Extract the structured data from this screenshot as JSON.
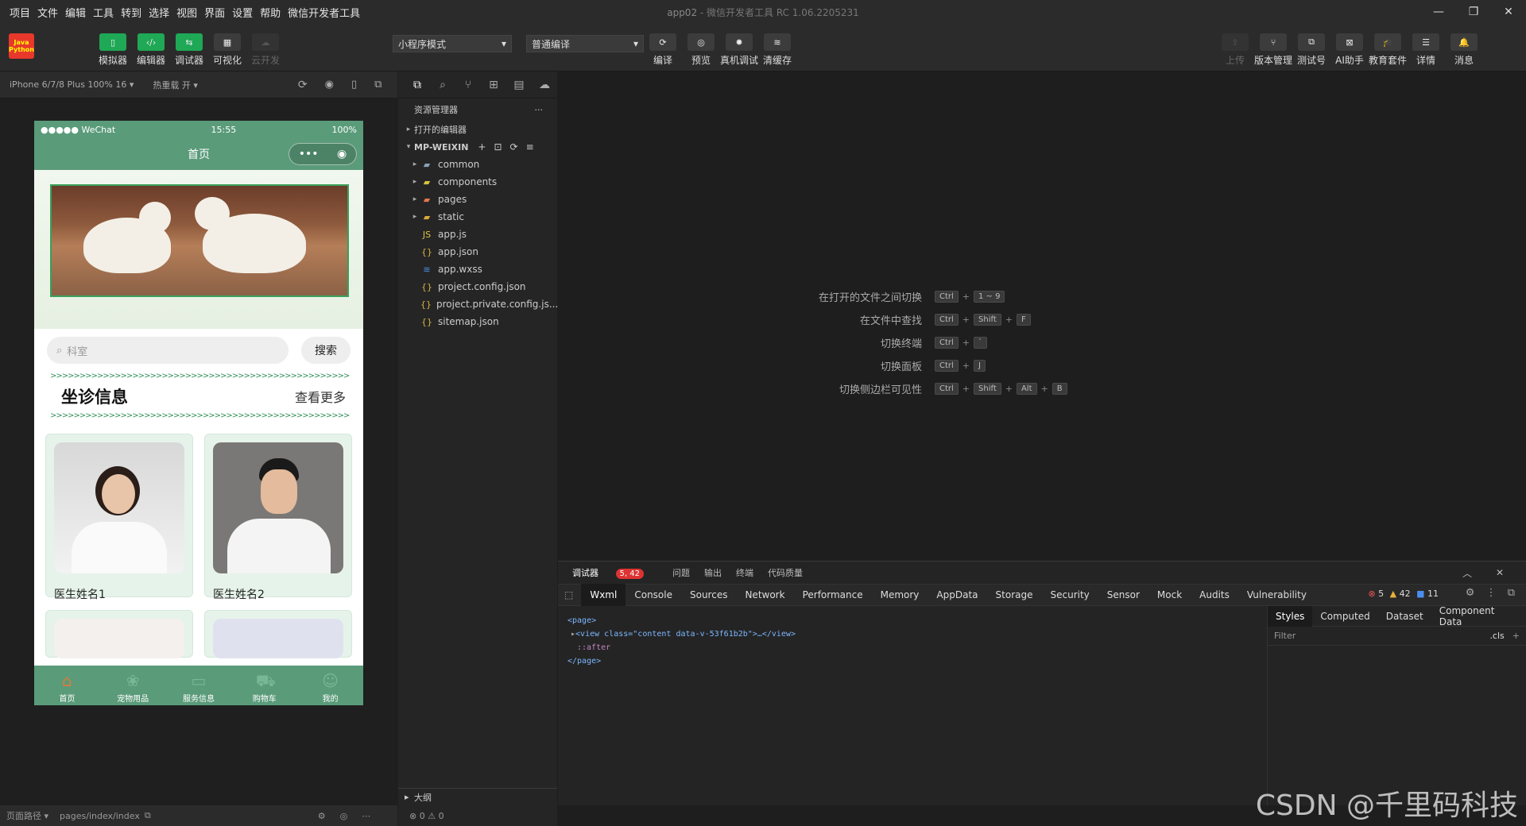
{
  "menu": [
    "项目",
    "文件",
    "编辑",
    "工具",
    "转到",
    "选择",
    "视图",
    "界面",
    "设置",
    "帮助",
    "微信开发者工具"
  ],
  "window": {
    "title": "app02",
    "subtitle": " - 微信开发者工具 RC 1.06.2205231"
  },
  "logo": {
    "line1": "Java",
    "line2": "Python"
  },
  "toolbar_left": [
    {
      "label": "模拟器",
      "icon": "phone-icon"
    },
    {
      "label": "编辑器",
      "icon": "code-icon"
    },
    {
      "label": "调试器",
      "icon": "debug-icon"
    },
    {
      "label": "可视化",
      "icon": "layout-icon"
    },
    {
      "label": "云开发",
      "icon": "cloud-icon"
    }
  ],
  "mode_select": "小程序模式",
  "compile_select": "普通编译",
  "toolbar_mid": [
    {
      "label": "编译"
    },
    {
      "label": "预览"
    },
    {
      "label": "真机调试"
    },
    {
      "label": "清缓存"
    }
  ],
  "toolbar_right": [
    {
      "label": "上传"
    },
    {
      "label": "版本管理"
    },
    {
      "label": "测试号"
    },
    {
      "label": "AI助手"
    },
    {
      "label": "教育套件"
    },
    {
      "label": "详情"
    },
    {
      "label": "消息"
    }
  ],
  "simbar": {
    "device": "iPhone 6/7/8 Plus 100% 16 ▾",
    "hotreload": "热重载 开 ▾"
  },
  "phone": {
    "carrier": "●●●●● WeChat",
    "time": "15:55",
    "battery": "100%",
    "nav_title": "首页",
    "search_placeholder": "科室",
    "search_button": "搜索",
    "arrows": ">>>>>>>>>>>>>>>>>>>>>>>>>>>>>>>>>>>>>>>>>>>>>>>>>>>",
    "section_title": "坐诊信息",
    "section_more": "查看更多",
    "doctors": [
      {
        "name": "医生姓名1"
      },
      {
        "name": "医生姓名2"
      }
    ],
    "tabs": [
      "首页",
      "宠物用品",
      "服务信息",
      "购物车",
      "我的"
    ]
  },
  "pathbar": {
    "label": "页面路径 ▾",
    "path": "pages/index/index"
  },
  "explorer": {
    "title": "资源管理器",
    "open_editors": "打开的编辑器",
    "root": "MP-WEIXIN",
    "items": [
      {
        "name": "common",
        "type": "folder"
      },
      {
        "name": "components",
        "type": "folder"
      },
      {
        "name": "pages",
        "type": "folder"
      },
      {
        "name": "static",
        "type": "folder"
      },
      {
        "name": "app.js",
        "type": "js"
      },
      {
        "name": "app.json",
        "type": "json"
      },
      {
        "name": "app.wxss",
        "type": "wxss"
      },
      {
        "name": "project.config.json",
        "type": "json"
      },
      {
        "name": "project.private.config.js...",
        "type": "json"
      },
      {
        "name": "sitemap.json",
        "type": "json"
      }
    ],
    "outline": "大纲",
    "status": "⊗ 0 ⚠ 0"
  },
  "shortcuts": [
    {
      "label": "在打开的文件之间切换",
      "keys": [
        "Ctrl",
        "1 ~ 9"
      ]
    },
    {
      "label": "在文件中查找",
      "keys": [
        "Ctrl",
        "Shift",
        "F"
      ]
    },
    {
      "label": "切换终端",
      "keys": [
        "Ctrl",
        "`"
      ]
    },
    {
      "label": "切换面板",
      "keys": [
        "Ctrl",
        "J"
      ]
    },
    {
      "label": "切换侧边栏可见性",
      "keys": [
        "Ctrl",
        "Shift",
        "Alt",
        "B"
      ]
    }
  ],
  "devtools": {
    "top_tabs": [
      "调试器",
      "问题",
      "输出",
      "终端",
      "代码质量"
    ],
    "badge": "5, 42",
    "tabs": [
      "Wxml",
      "Console",
      "Sources",
      "Network",
      "Performance",
      "Memory",
      "AppData",
      "Storage",
      "Security",
      "Sensor",
      "Mock",
      "Audits",
      "Vulnerability"
    ],
    "errors": "5",
    "warnings": "42",
    "infos": "11",
    "code": [
      "<page>",
      "<view class=\"content data-v-53f61b2b\">…</view>",
      "::after",
      "</page>"
    ],
    "style_tabs": [
      "Styles",
      "Computed",
      "Dataset",
      "Component Data"
    ],
    "filter_placeholder": "Filter",
    "cls": ".cls"
  },
  "watermark": "CSDN @千里码科技"
}
